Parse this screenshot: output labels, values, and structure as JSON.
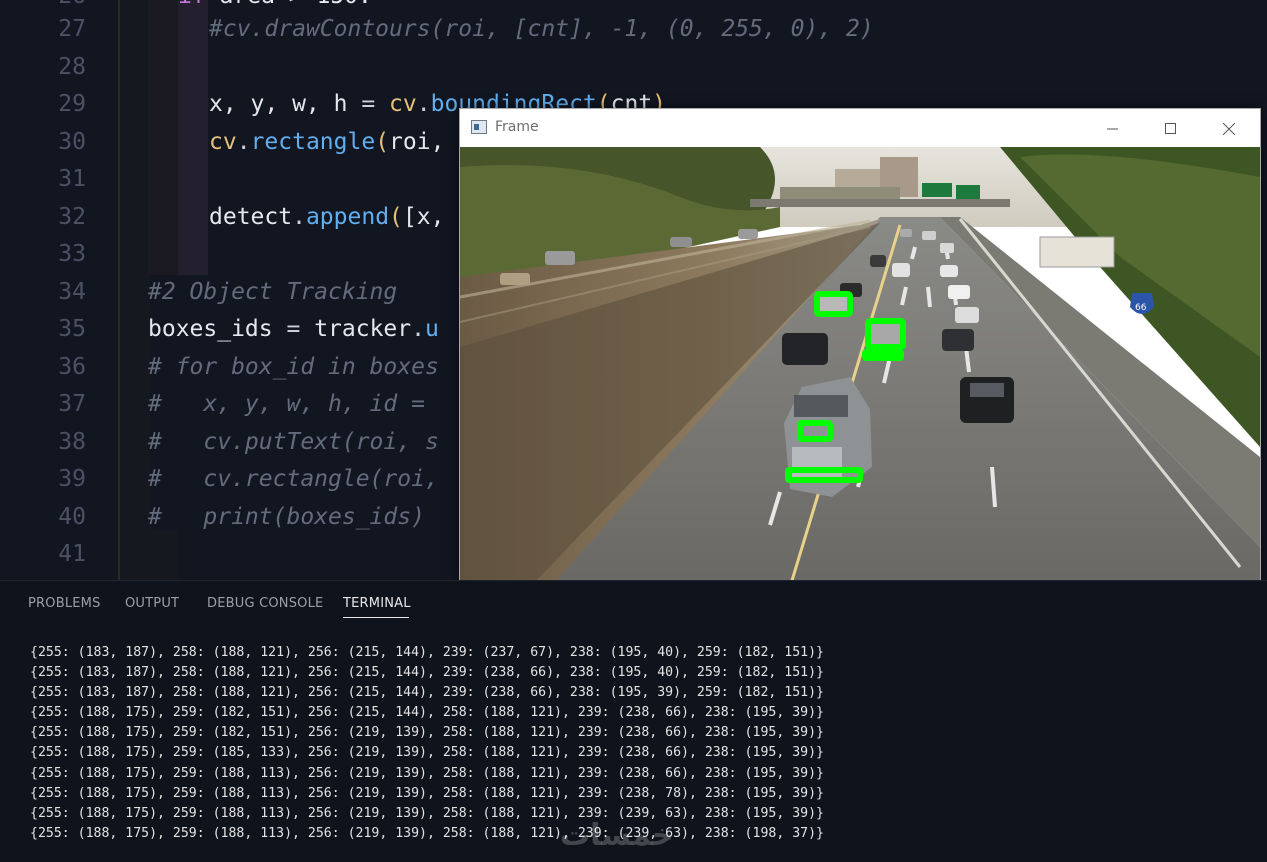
{
  "editor": {
    "top_line_partial": "area > 150:",
    "lines": [
      {
        "num": "27",
        "segments": [
          {
            "t": "#cv.drawContours(roi, [cnt], -1, (0, 255, 0), 2)",
            "c": "cmt"
          }
        ],
        "indent": 2
      },
      {
        "num": "28",
        "segments": [],
        "indent": 2
      },
      {
        "num": "29",
        "segments": [
          {
            "t": "x, y, w, h ",
            "c": "var"
          },
          {
            "t": "= ",
            "c": "pun"
          },
          {
            "t": "cv",
            "c": "obj"
          },
          {
            "t": ".",
            "c": "pun"
          },
          {
            "t": "boundingRect",
            "c": "fn"
          },
          {
            "t": "(",
            "c": "par"
          },
          {
            "t": "cnt",
            "c": "var"
          },
          {
            "t": ")",
            "c": "par"
          }
        ],
        "indent": 2
      },
      {
        "num": "30",
        "segments": [
          {
            "t": "cv",
            "c": "obj"
          },
          {
            "t": ".",
            "c": "pun"
          },
          {
            "t": "rectangle",
            "c": "fn"
          },
          {
            "t": "(",
            "c": "par"
          },
          {
            "t": "roi,",
            "c": "var"
          }
        ],
        "indent": 2
      },
      {
        "num": "31",
        "segments": [],
        "indent": 2
      },
      {
        "num": "32",
        "segments": [
          {
            "t": "detect",
            "c": "var"
          },
          {
            "t": ".",
            "c": "pun"
          },
          {
            "t": "append",
            "c": "fn"
          },
          {
            "t": "(",
            "c": "par"
          },
          {
            "t": "[x,",
            "c": "var"
          }
        ],
        "indent": 2
      },
      {
        "num": "33",
        "segments": [],
        "indent": 0
      },
      {
        "num": "34",
        "segments": [
          {
            "t": "#2 Object Tracking",
            "c": "cmt"
          }
        ],
        "indent": 0
      },
      {
        "num": "35",
        "segments": [
          {
            "t": "boxes_ids ",
            "c": "var"
          },
          {
            "t": "= ",
            "c": "pun"
          },
          {
            "t": "tracker",
            "c": "var"
          },
          {
            "t": ".",
            "c": "pun"
          },
          {
            "t": "u",
            "c": "fn"
          }
        ],
        "indent": 0
      },
      {
        "num": "36",
        "segments": [
          {
            "t": "# for box_id in boxes",
            "c": "cmt"
          }
        ],
        "indent": 0
      },
      {
        "num": "37",
        "segments": [
          {
            "t": "#   x, y, w, h, id =",
            "c": "cmt"
          }
        ],
        "indent": 0
      },
      {
        "num": "38",
        "segments": [
          {
            "t": "#   cv.putText(roi, s",
            "c": "cmt"
          }
        ],
        "indent": 0
      },
      {
        "num": "39",
        "segments": [
          {
            "t": "#   cv.rectangle(roi,",
            "c": "cmt"
          }
        ],
        "indent": 0
      },
      {
        "num": "40",
        "segments": [
          {
            "t": "#   print(boxes_ids)",
            "c": "cmt"
          }
        ],
        "indent": 0
      },
      {
        "num": "41",
        "segments": [],
        "indent": 0
      }
    ]
  },
  "frame_window": {
    "title": "Frame",
    "minimize_icon": "minimize-icon",
    "maximize_icon": "maximize-icon",
    "close_icon": "close-icon",
    "sign_text": "66",
    "detection_color": "#00ff00"
  },
  "panel": {
    "tabs": [
      {
        "label": "PROBLEMS",
        "active": false
      },
      {
        "label": "OUTPUT",
        "active": false
      },
      {
        "label": "DEBUG CONSOLE",
        "active": false
      },
      {
        "label": "TERMINAL",
        "active": true
      }
    ],
    "terminal_lines": [
      "{255: (183, 187), 258: (188, 121), 256: (215, 144), 239: (237, 67), 238: (195, 40), 259: (182, 151)}",
      "{255: (183, 187), 258: (188, 121), 256: (215, 144), 239: (238, 66), 238: (195, 40), 259: (182, 151)}",
      "{255: (183, 187), 258: (188, 121), 256: (215, 144), 239: (238, 66), 238: (195, 39), 259: (182, 151)}",
      "{255: (188, 175), 259: (182, 151), 256: (215, 144), 258: (188, 121), 239: (238, 66), 238: (195, 39)}",
      "{255: (188, 175), 259: (182, 151), 256: (219, 139), 258: (188, 121), 239: (238, 66), 238: (195, 39)}",
      "{255: (188, 175), 259: (185, 133), 256: (219, 139), 258: (188, 121), 239: (238, 66), 238: (195, 39)}",
      "{255: (188, 175), 259: (188, 113), 256: (219, 139), 258: (188, 121), 239: (238, 66), 238: (195, 39)}",
      "{255: (188, 175), 259: (188, 113), 256: (219, 139), 258: (188, 121), 239: (238, 78), 238: (195, 39)}",
      "{255: (188, 175), 259: (188, 113), 256: (219, 139), 258: (188, 121), 239: (239, 63), 238: (195, 39)}",
      "{255: (188, 175), 259: (188, 113), 256: (219, 139), 258: (188, 121), 239: (239, 63), 238: (198, 37)}"
    ],
    "watermark": "خمسات"
  }
}
